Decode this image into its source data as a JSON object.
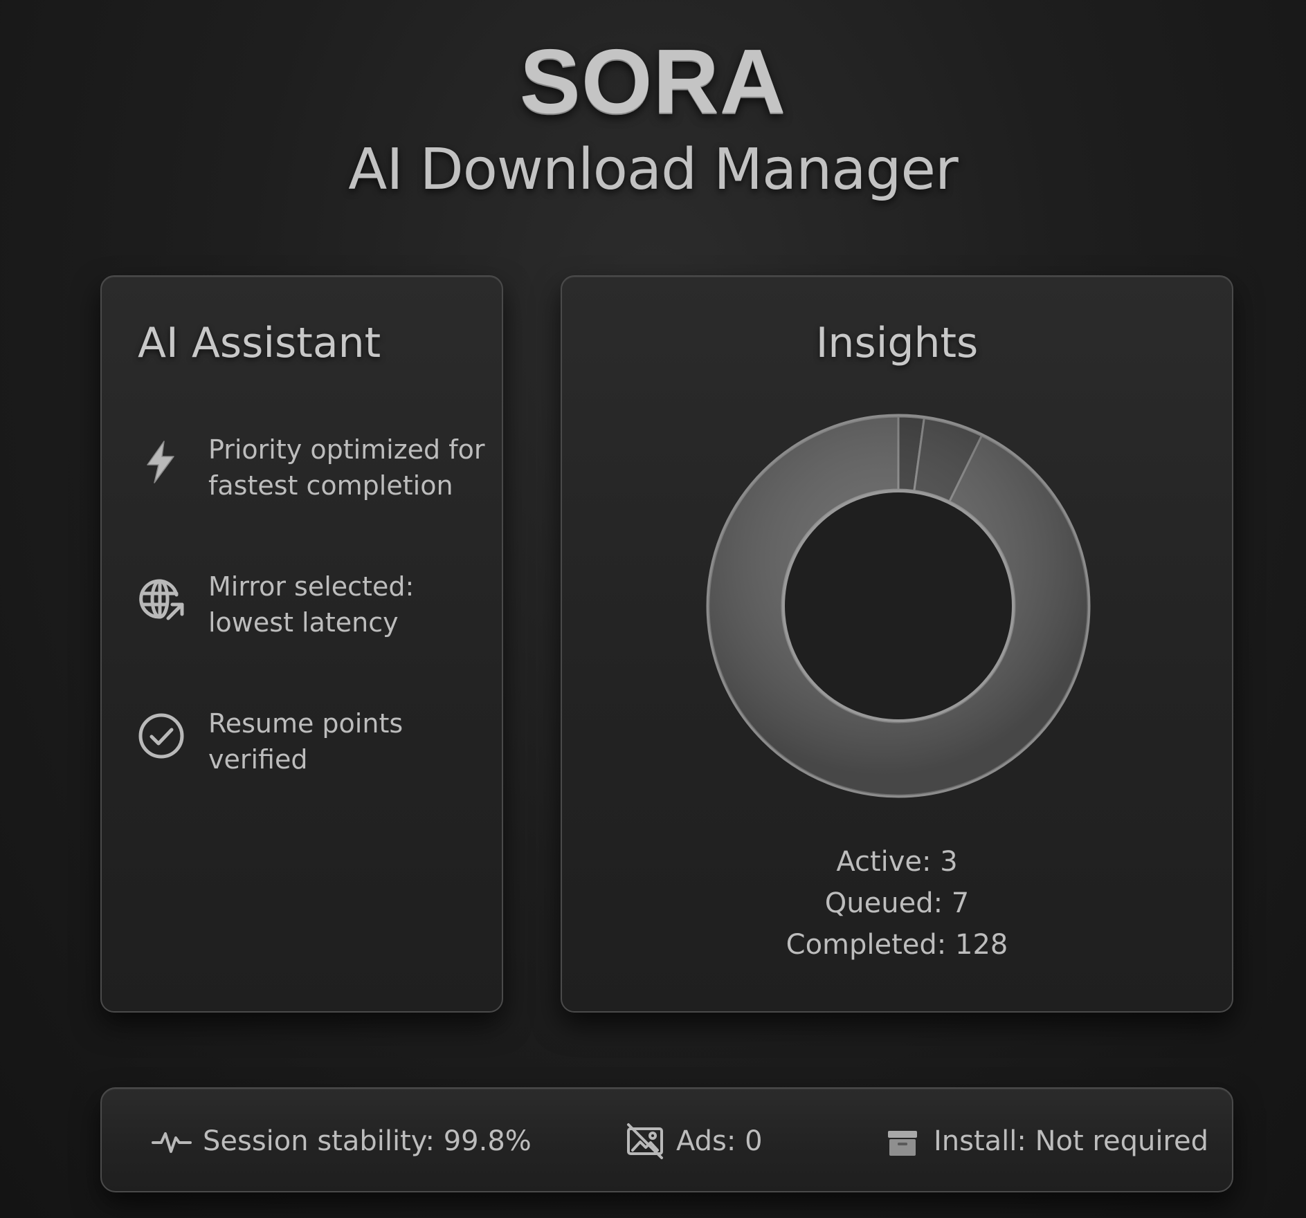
{
  "header": {
    "brand": "SORA",
    "subtitle": "AI Download Manager"
  },
  "assistant": {
    "title": "AI Assistant",
    "items": [
      {
        "icon": "lightning-icon",
        "text": "Priority optimized for fastest completion"
      },
      {
        "icon": "globe-arrow-icon",
        "text": "Mirror selected: lowest latency"
      },
      {
        "icon": "check-circle-icon",
        "text": "Resume points verified"
      }
    ]
  },
  "insights": {
    "title": "Insights",
    "stats": [
      {
        "label": "Active",
        "value": "3",
        "text": "Active: 3"
      },
      {
        "label": "Queued",
        "value": "7",
        "text": "Queued: 7"
      },
      {
        "label": "Completed",
        "value": "128",
        "text": "Completed: 128"
      }
    ]
  },
  "chart_data": {
    "type": "pie",
    "style": "donut",
    "categories": [
      "Active",
      "Queued",
      "Completed"
    ],
    "values": [
      3,
      7,
      128
    ],
    "colors": [
      "#3a3a3a",
      "#474747",
      "#5f5f5f"
    ]
  },
  "statusbar": {
    "items": [
      {
        "icon": "pulse-icon",
        "text": "Session stability: 99.8%"
      },
      {
        "icon": "ads-blocked-icon",
        "text": "Ads: 0"
      },
      {
        "icon": "box-icon",
        "text": "Install: Not required"
      }
    ]
  },
  "colors": {
    "background": "#1c1c1c",
    "panel": "#262626",
    "panel_border": "#4a4a4a",
    "text": "#bdbdbd",
    "title": "#c8c8c8"
  }
}
